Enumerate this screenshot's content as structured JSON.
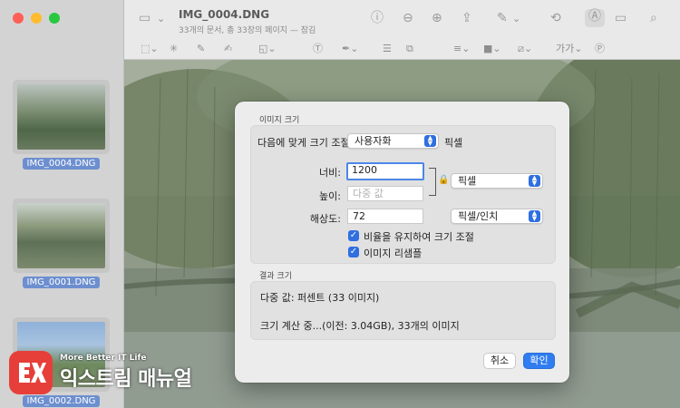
{
  "window": {
    "title": "IMG_0004.DNG",
    "subtitle": "33개의 문서, 총 33장의 페이지 — 잠김"
  },
  "sidebar": {
    "thumbnails": [
      {
        "label": "IMG_0004.DNG"
      },
      {
        "label": "IMG_0001.DNG"
      },
      {
        "label": "IMG_0002.DNG"
      }
    ]
  },
  "toolbar": {
    "font_menu": "가가"
  },
  "dialog": {
    "image_size_heading": "이미지 크기",
    "fit_label": "다음에 맞게 크기 조절:",
    "fit_value": "사용자화",
    "fit_unit": "픽셀",
    "width_label": "너비:",
    "width_value": "1200",
    "height_label": "높이:",
    "height_placeholder": "다중 값",
    "dimension_unit": "픽셀",
    "resolution_label": "해상도:",
    "resolution_value": "72",
    "resolution_unit": "픽셀/인치",
    "scale_proportionally": "비율을 유지하여 크기 조절",
    "resample_image": "이미지 리샘플",
    "result_heading": "결과 크기",
    "result_line1": "다중 값: 퍼센트 (33 이미지)",
    "result_line2": "크기 계산 중...(이전: 3.04GB), 33개의 이미지",
    "cancel_button": "취소",
    "ok_button": "확인"
  },
  "watermark": {
    "tagline": "More Better IT Life",
    "brand": "익스트림 매뉴얼"
  }
}
